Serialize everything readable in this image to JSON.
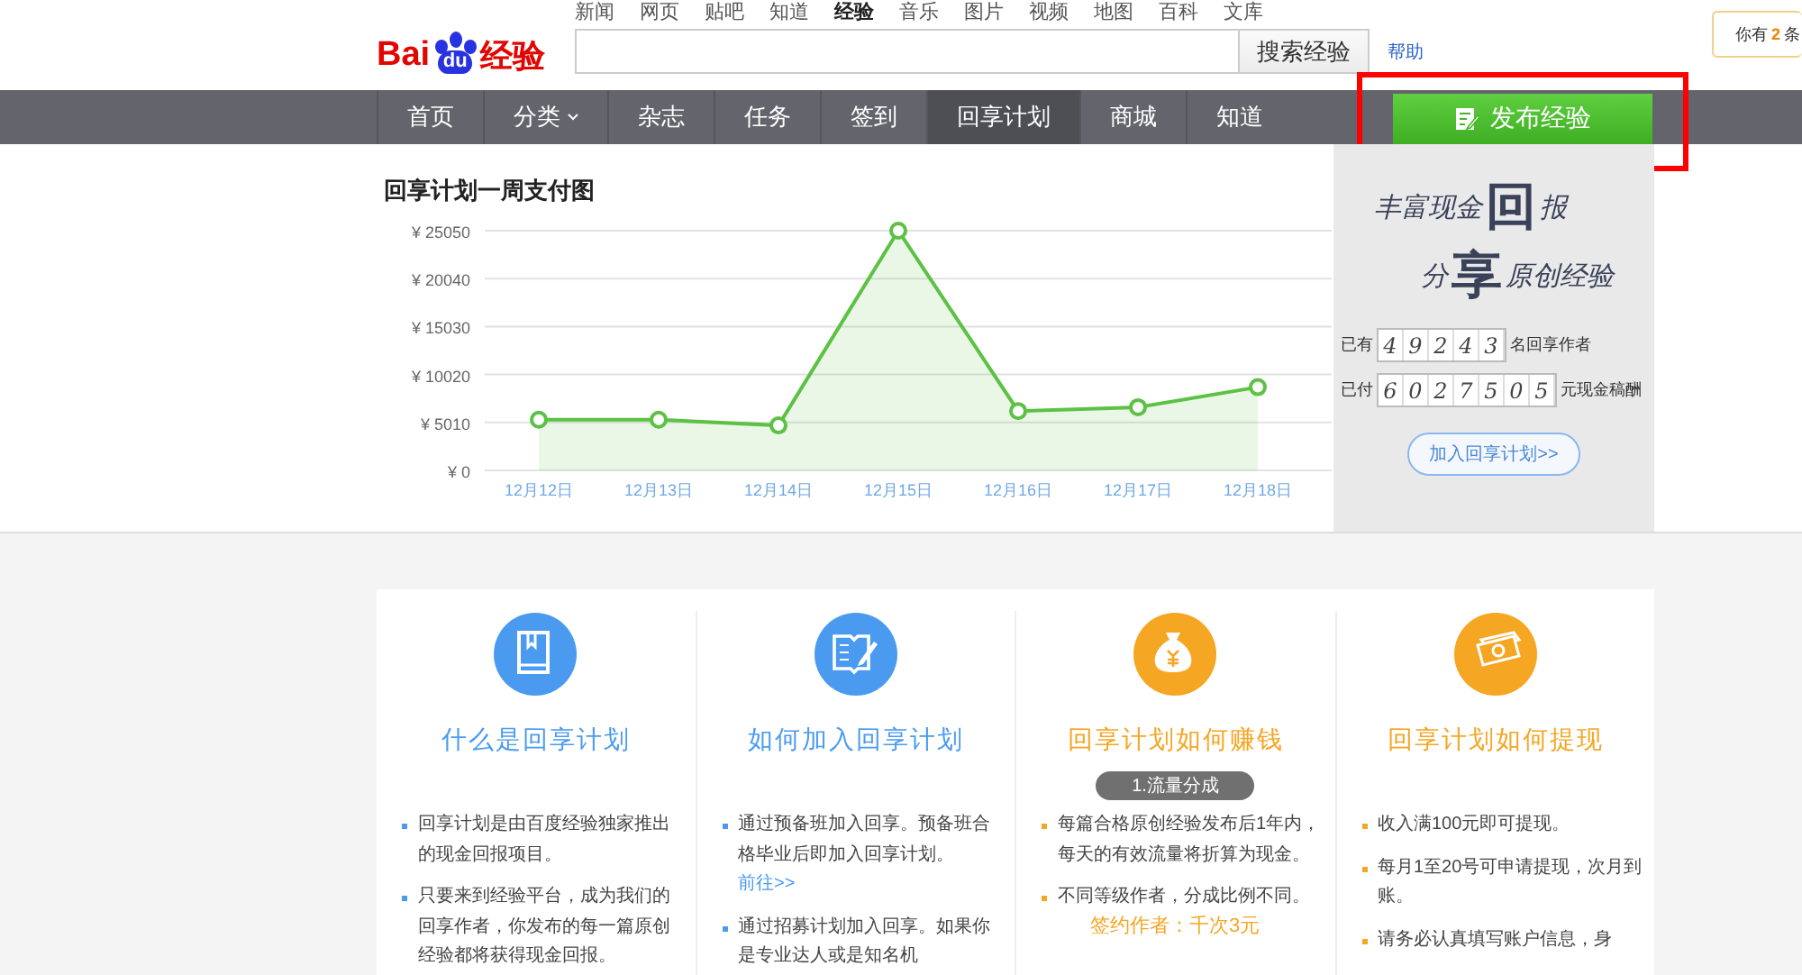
{
  "top_links": [
    {
      "label": "新闻",
      "selected": false
    },
    {
      "label": "网页",
      "selected": false
    },
    {
      "label": "贴吧",
      "selected": false
    },
    {
      "label": "知道",
      "selected": false
    },
    {
      "label": "经验",
      "selected": true
    },
    {
      "label": "音乐",
      "selected": false
    },
    {
      "label": "图片",
      "selected": false
    },
    {
      "label": "视频",
      "selected": false
    },
    {
      "label": "地图",
      "selected": false
    },
    {
      "label": "百科",
      "selected": false
    },
    {
      "label": "文库",
      "selected": false
    }
  ],
  "logo": {
    "left": "Bai",
    "paw": "du",
    "right": "经验"
  },
  "search": {
    "button": "搜索经验"
  },
  "help_link": "帮助",
  "notification": {
    "before": "你有",
    "count": "2",
    "after": "条"
  },
  "nav": {
    "items": [
      {
        "label": "首页",
        "selected": false,
        "dropdown": false
      },
      {
        "label": "分类",
        "selected": false,
        "dropdown": true
      },
      {
        "label": "杂志",
        "selected": false,
        "dropdown": false
      },
      {
        "label": "任务",
        "selected": false,
        "dropdown": false
      },
      {
        "label": "签到",
        "selected": false,
        "dropdown": false
      },
      {
        "label": "回享计划",
        "selected": true,
        "dropdown": false
      },
      {
        "label": "商城",
        "selected": false,
        "dropdown": false
      },
      {
        "label": "知道",
        "selected": false,
        "dropdown": false
      }
    ],
    "publish_button": {
      "label": "发布经验",
      "highlighted": true
    }
  },
  "chart_panel": {
    "title": "回享计划一周支付图",
    "chart_data": {
      "type": "area",
      "categories": [
        "12月12日",
        "12月13日",
        "12月14日",
        "12月15日",
        "12月16日",
        "12月17日",
        "12月18日"
      ],
      "grid": true,
      "series": [
        {
          "color": "#5cc144",
          "values": [
            5300,
            5300,
            4700,
            25050,
            6200,
            6600,
            8700
          ]
        }
      ],
      "ylim": [
        0,
        25050
      ],
      "yticks": [
        {
          "value": 0,
          "label": "¥ 0"
        },
        {
          "value": 5010,
          "label": "¥ 5010"
        },
        {
          "value": 10020,
          "label": "¥ 10020"
        },
        {
          "value": 15030,
          "label": "¥ 15030"
        },
        {
          "value": 20040,
          "label": "¥ 20040"
        },
        {
          "value": 25050,
          "label": "¥ 25050"
        }
      ]
    }
  },
  "banner": {
    "slogan_lines": [
      [
        {
          "text": "丰富现金",
          "kind": "small"
        },
        {
          "text": "回",
          "kind": "big"
        },
        {
          "text": "报",
          "kind": "small"
        }
      ],
      [
        {
          "text": "分",
          "kind": "small"
        },
        {
          "text": "享",
          "kind": "big"
        },
        {
          "text": "原创经验",
          "kind": "small"
        }
      ]
    ],
    "stats": [
      {
        "prefix": "已有",
        "digits": [
          "4",
          "9",
          "2",
          "4",
          "3"
        ],
        "suffix": "名回享作者"
      },
      {
        "prefix": "已付",
        "digits": [
          "6",
          "0",
          "2",
          "7",
          "5",
          "0",
          "5"
        ],
        "suffix": "元现金稿酬"
      }
    ],
    "join_button": "加入回享计划>>"
  },
  "sections": [
    {
      "title": "什么是回享计划",
      "color": "#4a9bf0",
      "items": [
        {
          "text": "回享计划是由百度经验独家推出的现金回报项目。"
        },
        {
          "text": "只要来到经验平台，成为我们的回享作者，你发布的每一篇原创经验都将获得现金回报。"
        }
      ]
    },
    {
      "title": "如何加入回享计划",
      "color": "#4a9bf0",
      "items": [
        {
          "text": "通过预备班加入回享。预备班合格毕业后即加入回享计划。",
          "link": "前往>>"
        },
        {
          "text": "通过招募计划加入回享。如果你是专业达人或是知名机"
        }
      ]
    },
    {
      "title": "回享计划如何赚钱",
      "color": "#f5a623",
      "badge": "1.流量分成",
      "items": [
        {
          "text": "每篇合格原创经验发布后1年内，每天的有效流量将折算为现金。"
        },
        {
          "text": "不同等级作者，分成比例不同。",
          "sub": [
            "签约作者：千次3元"
          ]
        }
      ]
    },
    {
      "title": "回享计划如何提现",
      "color": "#f5a623",
      "items": [
        {
          "text": "收入满100元即可提现。"
        },
        {
          "text": "每月1至20号可申请提现，次月到账。"
        },
        {
          "text": "请务必认真填写账户信息，身"
        }
      ]
    }
  ]
}
